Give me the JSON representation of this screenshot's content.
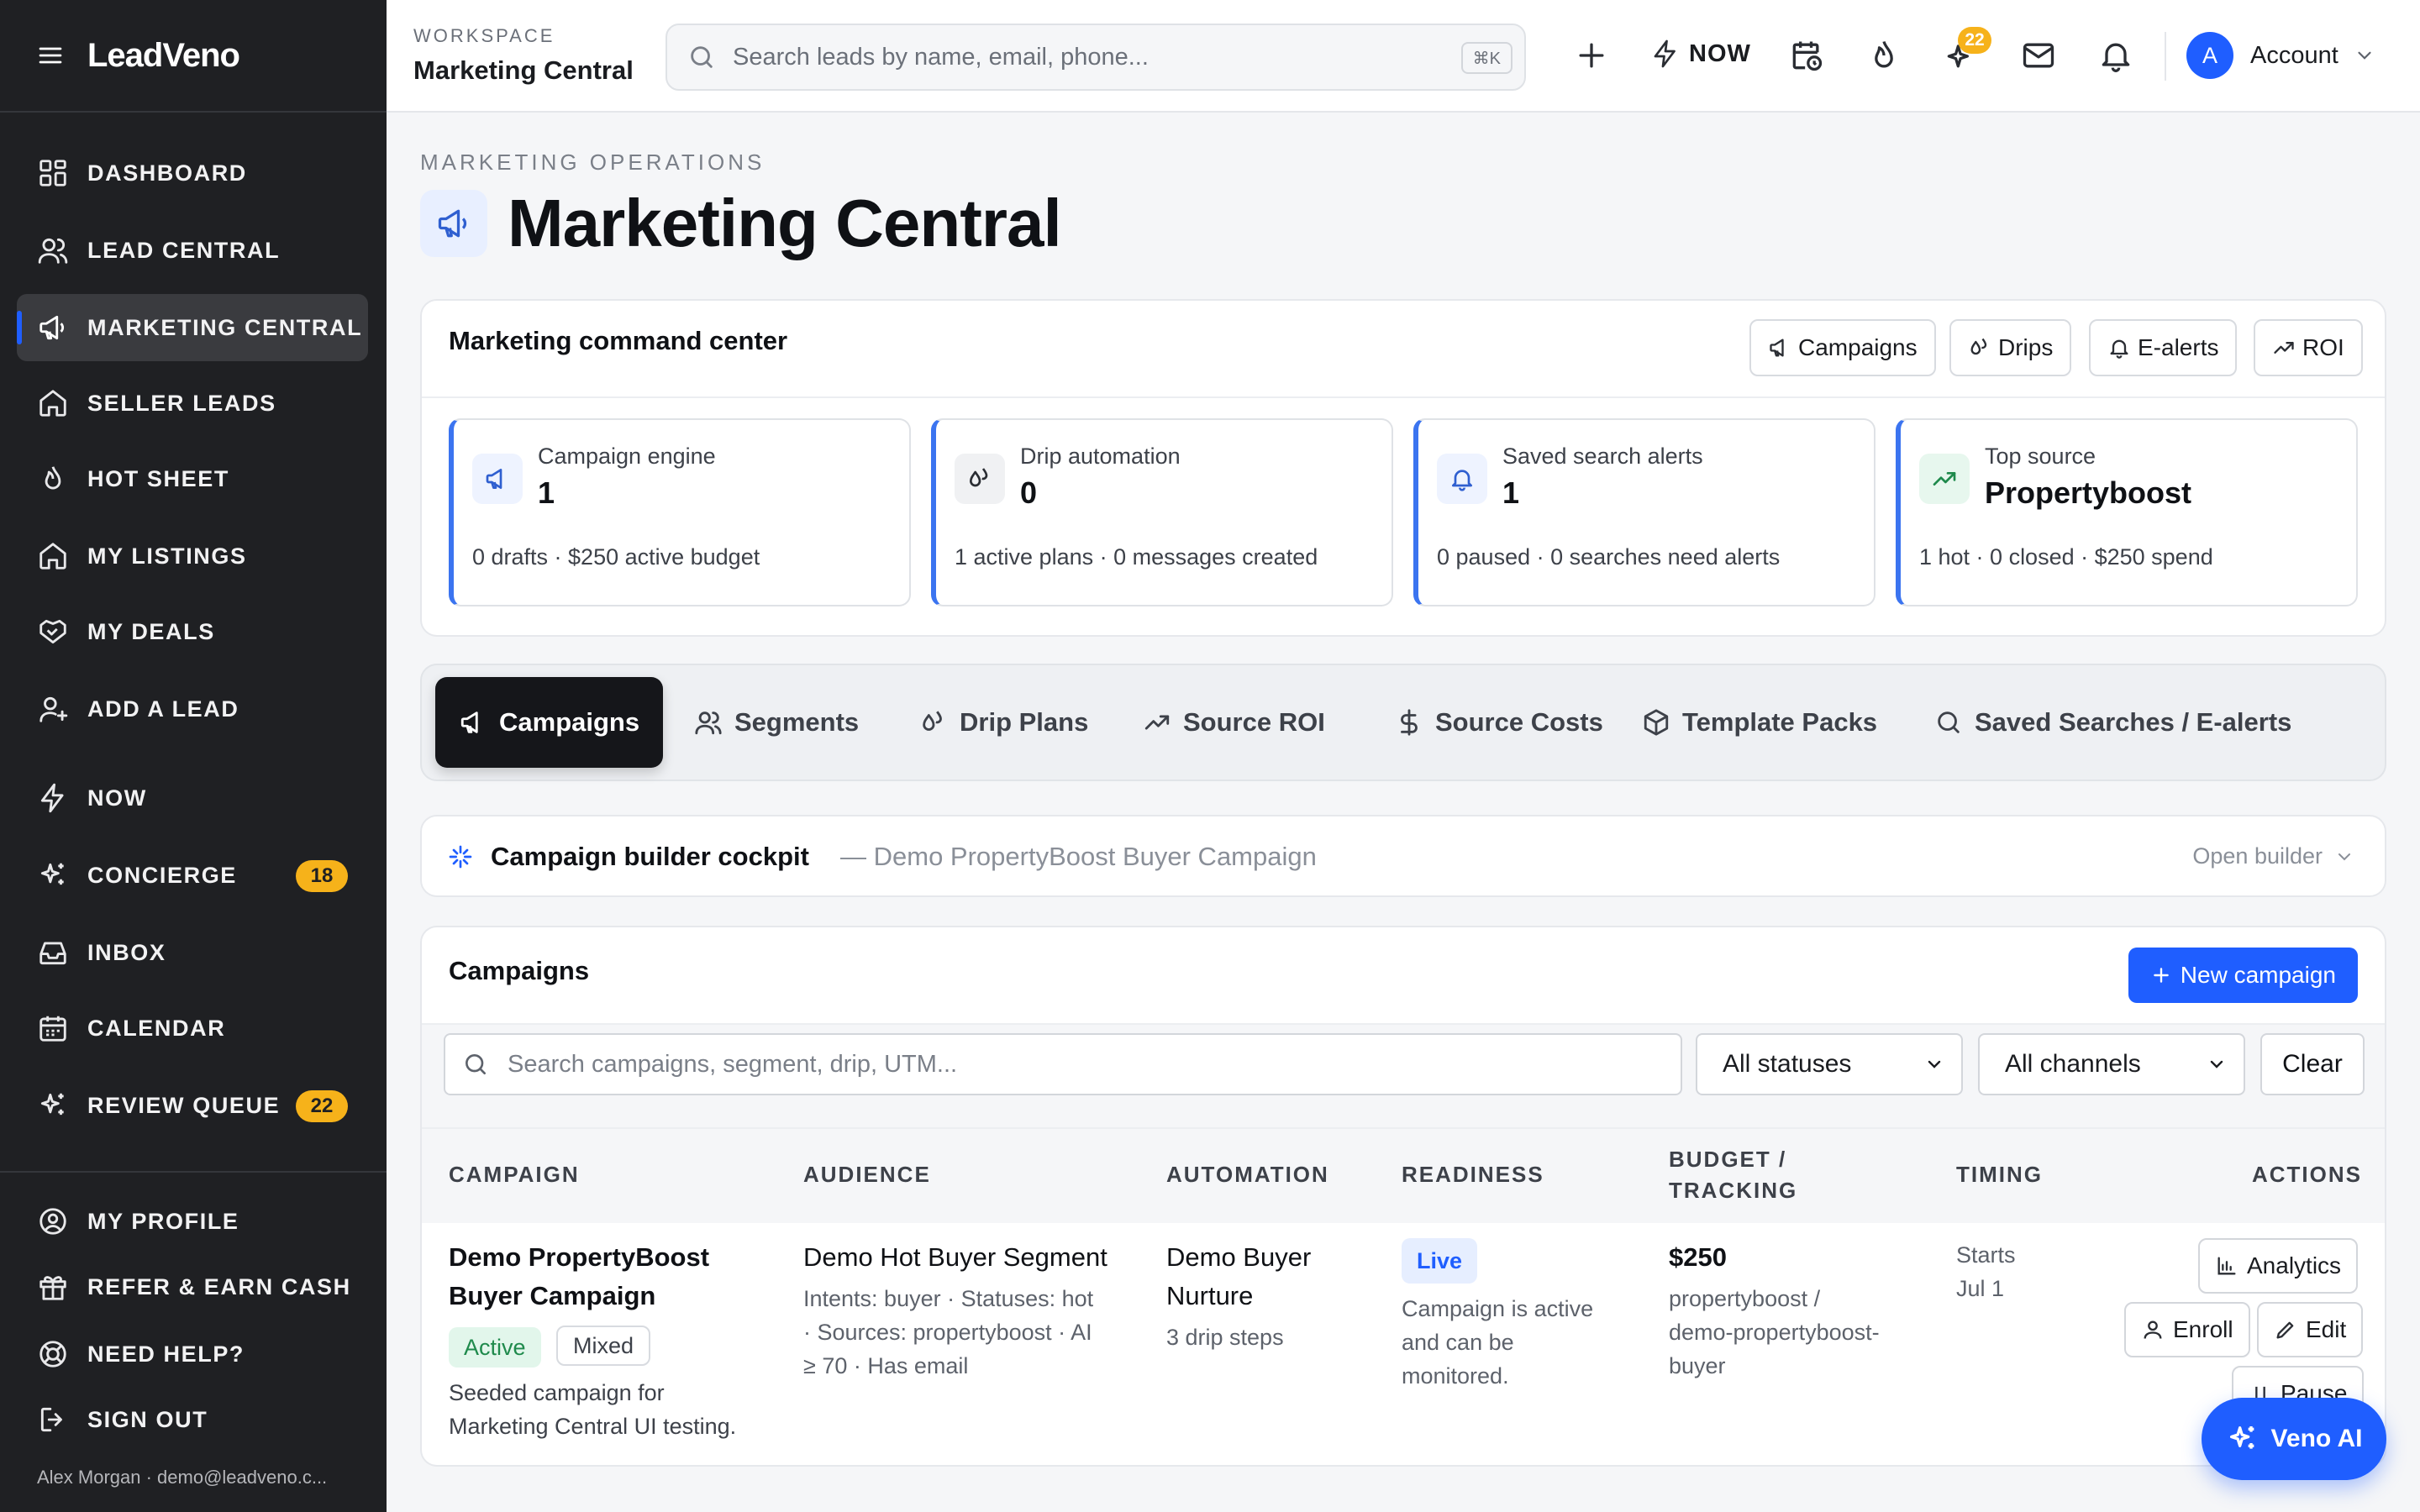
{
  "brand": {
    "name": "LeadVeno"
  },
  "sidebar": {
    "items": [
      {
        "label": "DASHBOARD",
        "icon": "dashboard-icon"
      },
      {
        "label": "LEAD CENTRAL",
        "icon": "users-icon"
      },
      {
        "label": "MARKETING CENTRAL",
        "icon": "megaphone-icon",
        "active": true
      },
      {
        "label": "SELLER LEADS",
        "icon": "home-icon"
      },
      {
        "label": "HOT SHEET",
        "icon": "flame-icon"
      },
      {
        "label": "MY LISTINGS",
        "icon": "home-icon"
      },
      {
        "label": "MY DEALS",
        "icon": "handshake-icon"
      },
      {
        "label": "ADD A LEAD",
        "icon": "user-plus-icon"
      },
      {
        "label": "NOW",
        "icon": "zap-icon"
      },
      {
        "label": "CONCIERGE",
        "icon": "sparkles-icon",
        "badge": "18"
      },
      {
        "label": "INBOX",
        "icon": "inbox-icon"
      },
      {
        "label": "CALENDAR",
        "icon": "calendar-icon"
      },
      {
        "label": "REVIEW QUEUE",
        "icon": "sparkles-icon",
        "badge": "22"
      }
    ],
    "bottom": [
      {
        "label": "MY PROFILE",
        "icon": "user-circle-icon"
      },
      {
        "label": "REFER & EARN CASH",
        "icon": "gift-icon"
      },
      {
        "label": "NEED HELP?",
        "icon": "lifebuoy-icon"
      },
      {
        "label": "SIGN OUT",
        "icon": "logout-icon"
      }
    ],
    "user": "Alex Morgan · demo@leadveno.c..."
  },
  "topbar": {
    "workspace_label": "WORKSPACE",
    "workspace_name": "Marketing Central",
    "search_placeholder": "Search leads by name, email, phone...",
    "search_shortcut": "⌘K",
    "now_label": "NOW",
    "concierge_badge": "22",
    "avatar_letter": "A",
    "account_label": "Account"
  },
  "page": {
    "eyebrow": "MARKETING OPERATIONS",
    "title": "Marketing Central"
  },
  "command_center": {
    "title": "Marketing command center",
    "quick_buttons": [
      "Campaigns",
      "Drips",
      "E-alerts",
      "ROI"
    ],
    "stats": [
      {
        "label": "Campaign engine",
        "value": "1",
        "sub": "0 drafts · $250 active budget"
      },
      {
        "label": "Drip automation",
        "value": "0",
        "sub": "1 active plans · 0 messages created"
      },
      {
        "label": "Saved search alerts",
        "value": "1",
        "sub": "0 paused · 0 searches need alerts"
      },
      {
        "label": "Top source",
        "value": "Propertyboost",
        "sub": "1 hot · 0 closed · $250 spend"
      }
    ]
  },
  "tabs": [
    "Campaigns",
    "Segments",
    "Drip Plans",
    "Source ROI",
    "Source Costs",
    "Template Packs",
    "Saved Searches / E-alerts"
  ],
  "cockpit": {
    "title": "Campaign builder cockpit",
    "subtitle": "— Demo PropertyBoost Buyer Campaign",
    "open_label": "Open builder"
  },
  "campaigns": {
    "title": "Campaigns",
    "new_button": "New campaign",
    "search_placeholder": "Search campaigns, segment, drip, UTM...",
    "status_filter": "All statuses",
    "channel_filter": "All channels",
    "clear_label": "Clear",
    "columns": {
      "campaign": "CAMPAIGN",
      "audience": "AUDIENCE",
      "automation": "AUTOMATION",
      "readiness": "READINESS",
      "budget_1": "BUDGET /",
      "budget_2": "TRACKING",
      "timing": "TIMING",
      "actions": "ACTIONS"
    },
    "row": {
      "name_1": "Demo PropertyBoost",
      "name_2": "Buyer Campaign",
      "status": "Active",
      "channel": "Mixed",
      "desc_1": "Seeded campaign for",
      "desc_2": "Marketing Central UI testing.",
      "audience_name": "Demo Hot Buyer Segment",
      "audience_1": "Intents: buyer · Statuses: hot",
      "audience_2": "· Sources: propertyboost · AI",
      "audience_3": "≥ 70 · Has email",
      "automation_1": "Demo Buyer",
      "automation_2": "Nurture",
      "automation_sub": "3 drip steps",
      "readiness": "Live",
      "readiness_1": "Campaign is active",
      "readiness_2": "and can be",
      "readiness_3": "monitored.",
      "budget": "$250",
      "tracking_1": "propertyboost /",
      "tracking_2": "demo-propertyboost-",
      "tracking_3": "buyer",
      "timing_1": "Starts",
      "timing_2": "Jul 1",
      "actions": [
        "Analytics",
        "Enroll",
        "Edit",
        "Pause"
      ]
    }
  },
  "assistant": {
    "label": "Veno AI"
  },
  "colors": {
    "accent": "#1f5eff",
    "sidebar": "#1f2023",
    "badge": "#f6b21a",
    "active_green": "#1f8a4c"
  }
}
